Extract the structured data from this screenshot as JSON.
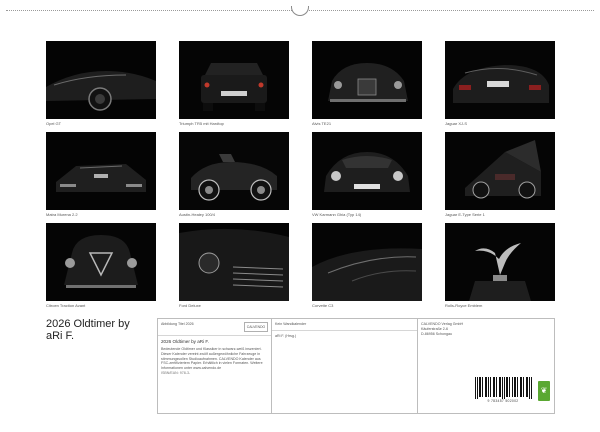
{
  "calendar": {
    "title": "2026 Oldtimer by aRi F.",
    "photos": [
      {
        "caption": "Opel GT",
        "icon": "sports-car-side-photo"
      },
      {
        "caption": "Triumph TR5 mit Hardtop",
        "icon": "car-rear-photo"
      },
      {
        "caption": "Alvis TE21",
        "icon": "saloon-front-photo"
      },
      {
        "caption": "Jaguar XJ-S",
        "icon": "coupe-rear-photo"
      },
      {
        "caption": "Matra Murena 2.2",
        "icon": "wedge-car-front-photo"
      },
      {
        "caption": "Austin-Healey 100/4",
        "icon": "roadster-front-photo"
      },
      {
        "caption": "VW Karmann Ghia (Typ 14)",
        "icon": "coupe-front-photo"
      },
      {
        "caption": "Jaguar E-Type Serie 1",
        "icon": "roadster-open-hood-photo"
      },
      {
        "caption": "Citroen Traction Avant",
        "icon": "vintage-saloon-photo"
      },
      {
        "caption": "Ford Deluxe",
        "icon": "grille-detail-photo"
      },
      {
        "caption": "Corvette C3",
        "icon": "corvette-detail-photo"
      },
      {
        "caption": "Rolls-Royce Emblem",
        "icon": "hood-ornament-photo"
      }
    ]
  },
  "info": {
    "artwork_label": "Abbildung",
    "artwork_value": "Titel 2026",
    "publisher_logo": "CALVENDO",
    "product_title": "2026 Oldtimer by aRi F.",
    "description": "Bedeutende Oldtimer und Klassiker in schwarz-weiß inszeniert. Dieser Kalender vereint zwölf außergewöhnliche Fahrzeuge in stimmungsvollen Studioaufnahmen. CALVENDO Kalender aus FSC-zertifiziertem Papier. Erhältlich in vielen Formaten. Weitere Informationen unter www.calvendo.de",
    "ean": "ISBN/EAN: 978-3-",
    "col2_label": "Kein Wandkalender",
    "col2_line": "aRi F. (Hrsg.)",
    "publisher_name": "CALVENDO Verlag GmbH",
    "publisher_addr1": "Käuferstraße 2-6",
    "publisher_addr2": "D-86956 Schongau",
    "barcode_number": "9 783457 502002",
    "eco_logo": "leaf-icon"
  }
}
